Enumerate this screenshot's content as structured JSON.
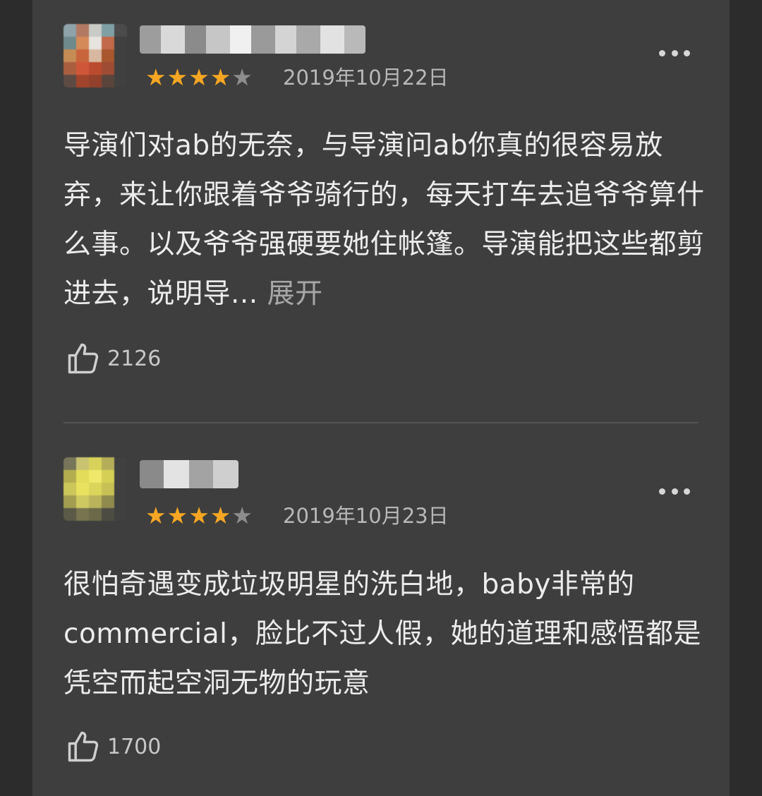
{
  "reviews": [
    {
      "rating": 4,
      "rating_max": 5,
      "date": "2019年10月22日",
      "text": "导演们对ab的无奈，与导演问ab你真的很容易放弃，来让你跟着爷爷骑行的，每天打车去追爷爷算什么事。以及爷爷强硬要她住帐篷。导演能把这些都剪进去，说明导...",
      "expand_label": "展开",
      "likes": "2126"
    },
    {
      "rating": 4,
      "rating_max": 5,
      "date": "2019年10月23日",
      "text": "很怕奇遇变成垃圾明星的洗白地，baby非常的commercial，脸比不过人假，她的道理和感悟都是凭空而起空洞无物的玩意",
      "expand_label": "",
      "likes": "1700"
    }
  ],
  "colors": {
    "background": "#2b2c2b",
    "card": "#3d3e3d",
    "star_on": "#f6a623",
    "star_off": "#8d8d8d",
    "text": "#ececec",
    "meta": "#b8b8b8"
  },
  "icons": [
    "more-dots-icon",
    "thumbs-up-icon",
    "star-icon"
  ]
}
